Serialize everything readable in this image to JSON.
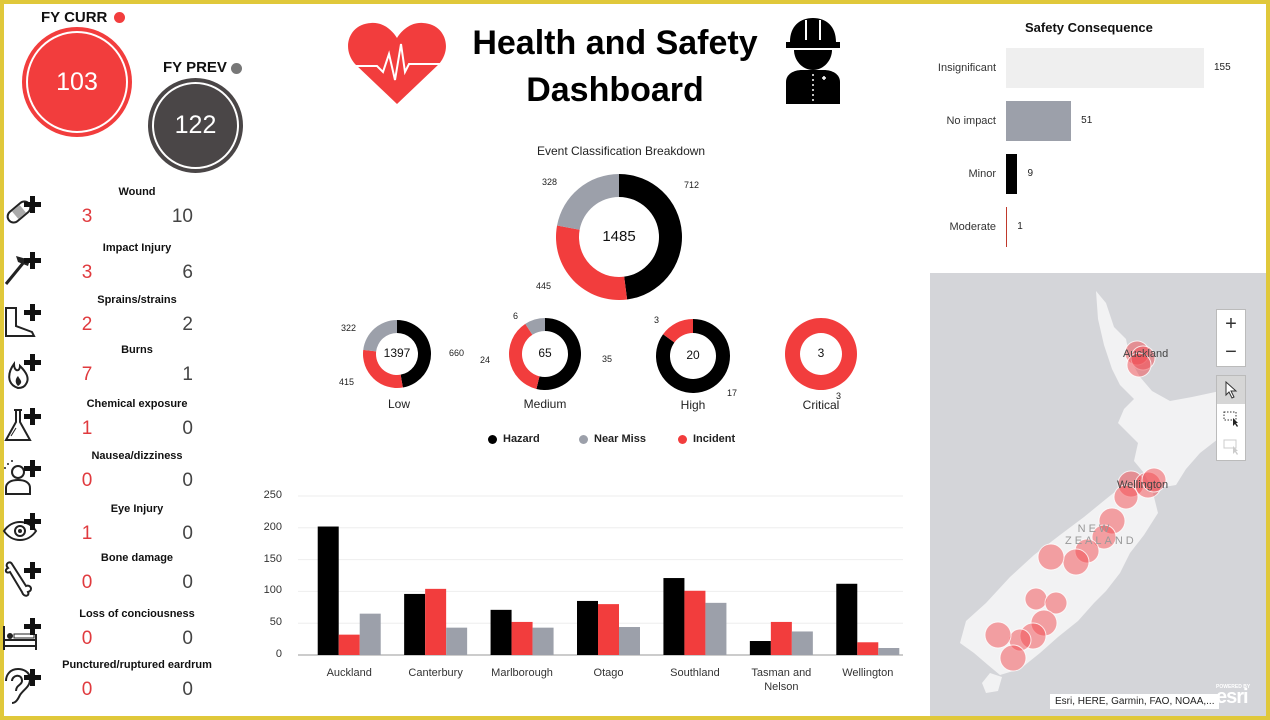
{
  "header": {
    "title_line1": "Health and Safety",
    "title_line2": "Dashboard",
    "left_icon": "heart-pulse-icon",
    "right_icon": "worker-hardhat-icon"
  },
  "kpis": {
    "current": {
      "label": "FY CURR",
      "value": "103",
      "color": "#f23d3d"
    },
    "previous": {
      "label": "FY PREV",
      "value": "122",
      "color": "#4a4647"
    }
  },
  "injuries": [
    {
      "name": "Wound",
      "icon": "bandage-icon",
      "curr": "3",
      "prev": "10"
    },
    {
      "name": "Impact Injury",
      "icon": "hammer-icon",
      "curr": "3",
      "prev": "6"
    },
    {
      "name": "Sprains/strains",
      "icon": "foot-icon",
      "curr": "2",
      "prev": "2"
    },
    {
      "name": "Burns",
      "icon": "fire-icon",
      "curr": "7",
      "prev": "1"
    },
    {
      "name": "Chemical exposure",
      "icon": "flask-icon",
      "curr": "1",
      "prev": "0"
    },
    {
      "name": "Nausea/dizziness",
      "icon": "dizzy-person-icon",
      "curr": "0",
      "prev": "0"
    },
    {
      "name": "Eye Injury",
      "icon": "eye-icon",
      "curr": "1",
      "prev": "0"
    },
    {
      "name": "Bone damage",
      "icon": "bone-icon",
      "curr": "0",
      "prev": "0"
    },
    {
      "name": "Loss of conciousness",
      "icon": "bed-icon",
      "curr": "0",
      "prev": "0"
    },
    {
      "name": "Punctured/ruptured eardrum",
      "icon": "ear-icon",
      "curr": "0",
      "prev": "0"
    }
  ],
  "colors": {
    "hazard": "#000000",
    "near_miss": "#9ca0aa",
    "incident": "#f23d3d",
    "insignificant": "#efefef",
    "frame": "#e0c83a"
  },
  "chart_data": [
    {
      "type": "pie",
      "title": "Event Classification Breakdown",
      "center_label": "1485",
      "categories": [
        "Hazard",
        "Incident",
        "Near Miss"
      ],
      "values": [
        712,
        445,
        328
      ]
    },
    {
      "type": "pie",
      "title": "Low",
      "center_label": "1397",
      "categories": [
        "Hazard",
        "Incident",
        "Near Miss"
      ],
      "values": [
        660,
        415,
        322
      ]
    },
    {
      "type": "pie",
      "title": "Medium",
      "center_label": "65",
      "categories": [
        "Hazard",
        "Incident",
        "Near Miss"
      ],
      "values": [
        35,
        24,
        6
      ]
    },
    {
      "type": "pie",
      "title": "High",
      "center_label": "20",
      "categories": [
        "Hazard",
        "Incident"
      ],
      "values": [
        17,
        3
      ]
    },
    {
      "type": "pie",
      "title": "Critical",
      "center_label": "3",
      "categories": [
        "Incident"
      ],
      "values": [
        3
      ]
    },
    {
      "type": "bar",
      "title": "Safety Consequence",
      "orientation": "horizontal",
      "categories": [
        "Insignificant",
        "No impact",
        "Minor",
        "Moderate"
      ],
      "values": [
        155,
        51,
        9,
        1
      ],
      "xlim": [
        0,
        155
      ]
    },
    {
      "type": "bar",
      "title": "",
      "categories": [
        "Auckland",
        "Canterbury",
        "Marlborough",
        "Otago",
        "Southland",
        "Tasman and Nelson",
        "Wellington"
      ],
      "series": [
        {
          "name": "Hazard",
          "values": [
            202,
            96,
            71,
            85,
            121,
            22,
            112
          ]
        },
        {
          "name": "Incident",
          "values": [
            32,
            104,
            52,
            80,
            101,
            52,
            20
          ]
        },
        {
          "name": "Near Miss",
          "values": [
            65,
            43,
            43,
            44,
            82,
            37,
            11
          ]
        }
      ],
      "yticks": [
        "0",
        "50",
        "100",
        "150",
        "200",
        "250"
      ],
      "ylim": [
        0,
        250
      ],
      "grid": true
    }
  ],
  "legend": {
    "items": [
      {
        "label": "Hazard",
        "color": "#000000"
      },
      {
        "label": "Near Miss",
        "color": "#9ca0aa"
      },
      {
        "label": "Incident",
        "color": "#f23d3d"
      }
    ]
  },
  "map": {
    "labels": {
      "auckland": "Auckland",
      "wellington": "Wellington",
      "country_line1": "NEW",
      "country_line2": "ZEALAND"
    },
    "zoom_in": "+",
    "zoom_out": "−",
    "attribution": "Esri, HERE, Garmin, FAO, NOAA,...",
    "powered_by": "POWERED BY",
    "brand": "esri"
  }
}
